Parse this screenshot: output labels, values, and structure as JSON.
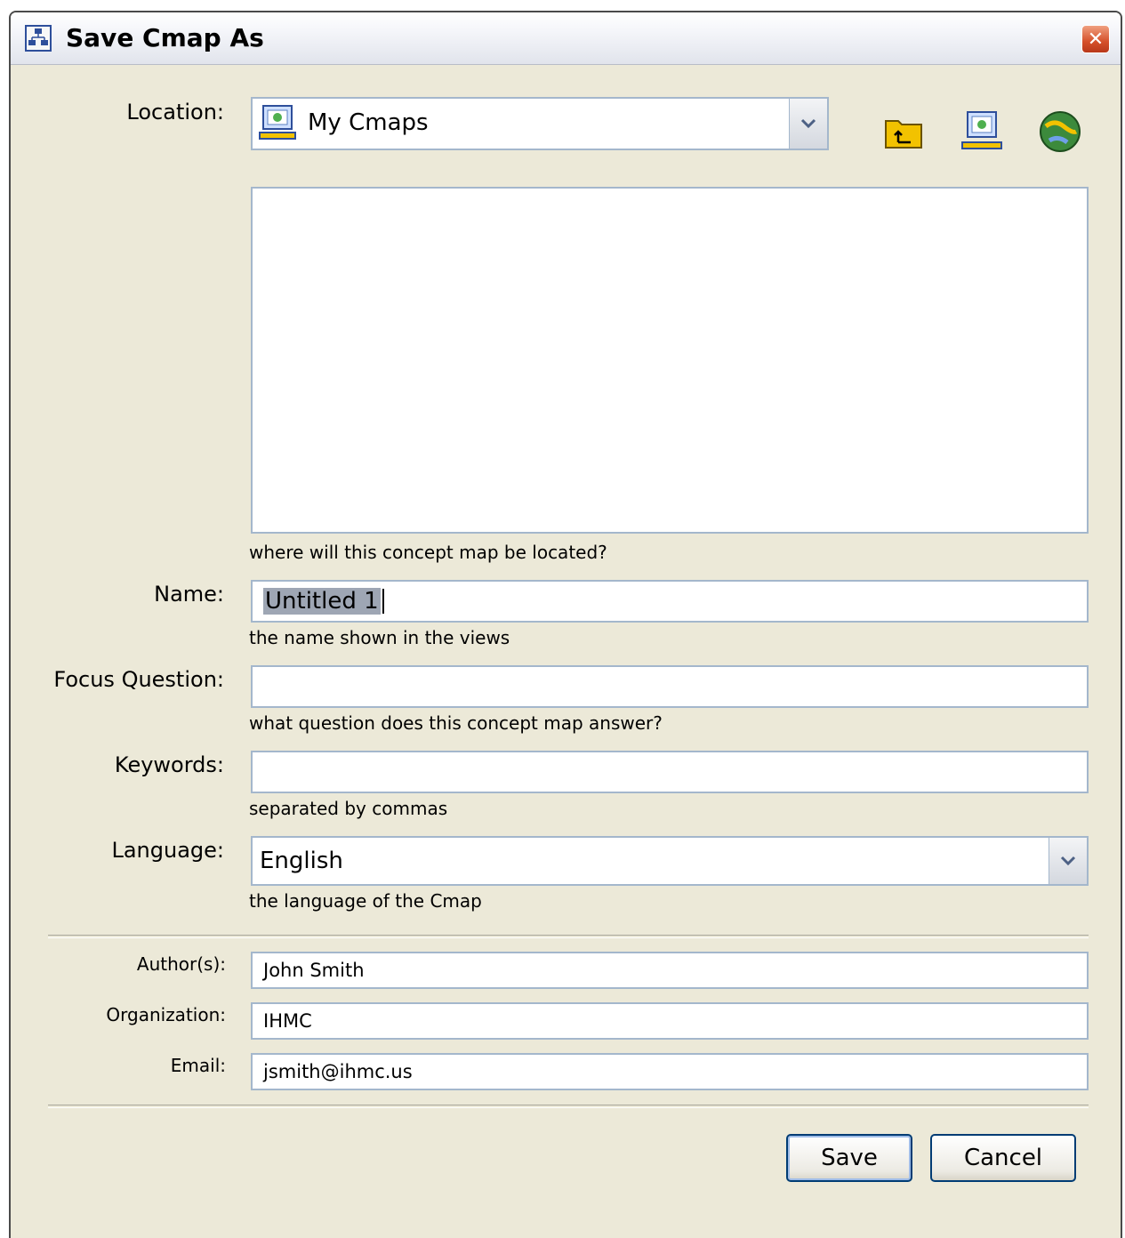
{
  "window": {
    "title": "Save Cmap As"
  },
  "location": {
    "label": "Location:",
    "value": "My Cmaps",
    "hint": "where will this concept map be located?"
  },
  "name": {
    "label": "Name:",
    "value": "Untitled 1",
    "hint": "the name shown in the views"
  },
  "focus_question": {
    "label": "Focus Question:",
    "value": "",
    "hint": "what question does this concept map answer?"
  },
  "keywords": {
    "label": "Keywords:",
    "value": "",
    "hint": "separated by commas"
  },
  "language": {
    "label": "Language:",
    "value": "English",
    "hint": "the language of the Cmap"
  },
  "authors": {
    "label": "Author(s):",
    "value": "John Smith"
  },
  "organization": {
    "label": "Organization:",
    "value": "IHMC"
  },
  "email": {
    "label": "Email:",
    "value": "jsmith@ihmc.us"
  },
  "buttons": {
    "save": "Save",
    "cancel": "Cancel"
  },
  "icons": {
    "title": "cmap-app-icon",
    "close": "close-icon",
    "location": "my-computer-icon",
    "up_folder": "up-folder-icon",
    "my_cmaps": "my-computer-icon",
    "shared_places": "globe-icon",
    "dropdown": "chevron-down-icon"
  }
}
